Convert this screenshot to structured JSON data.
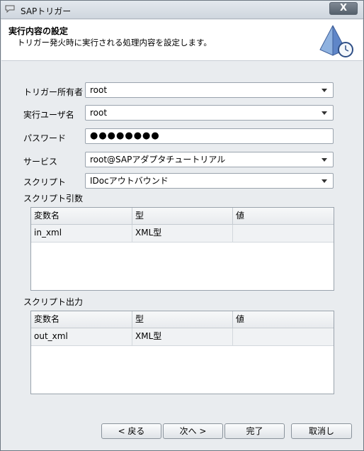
{
  "window": {
    "title": "SAPトリガー",
    "close_label": "X"
  },
  "header": {
    "title": "実行内容の設定",
    "description": "トリガー発火時に実行される処理内容を設定します。"
  },
  "form": {
    "owner": {
      "label": "トリガー所有者",
      "value": "root"
    },
    "exec_user": {
      "label": "実行ユーザ名",
      "value": "root"
    },
    "password": {
      "label": "パスワード",
      "value": "●●●●●●●●"
    },
    "service": {
      "label": "サービス",
      "value": "root@SAPアダプタチュートリアル"
    },
    "script": {
      "label": "スクリプト",
      "value": "IDocアウトバウンド"
    }
  },
  "script_args": {
    "label": "スクリプト引数",
    "columns": [
      "変数名",
      "型",
      "値"
    ],
    "rows": [
      {
        "name": "in_xml",
        "type": "XML型",
        "value": ""
      }
    ]
  },
  "script_output": {
    "label": "スクリプト出力",
    "columns": [
      "変数名",
      "型",
      "値"
    ],
    "rows": [
      {
        "name": "out_xml",
        "type": "XML型",
        "value": ""
      }
    ]
  },
  "buttons": {
    "back": "< 戻る",
    "next": "次へ >",
    "finish": "完了",
    "cancel": "取消し"
  }
}
